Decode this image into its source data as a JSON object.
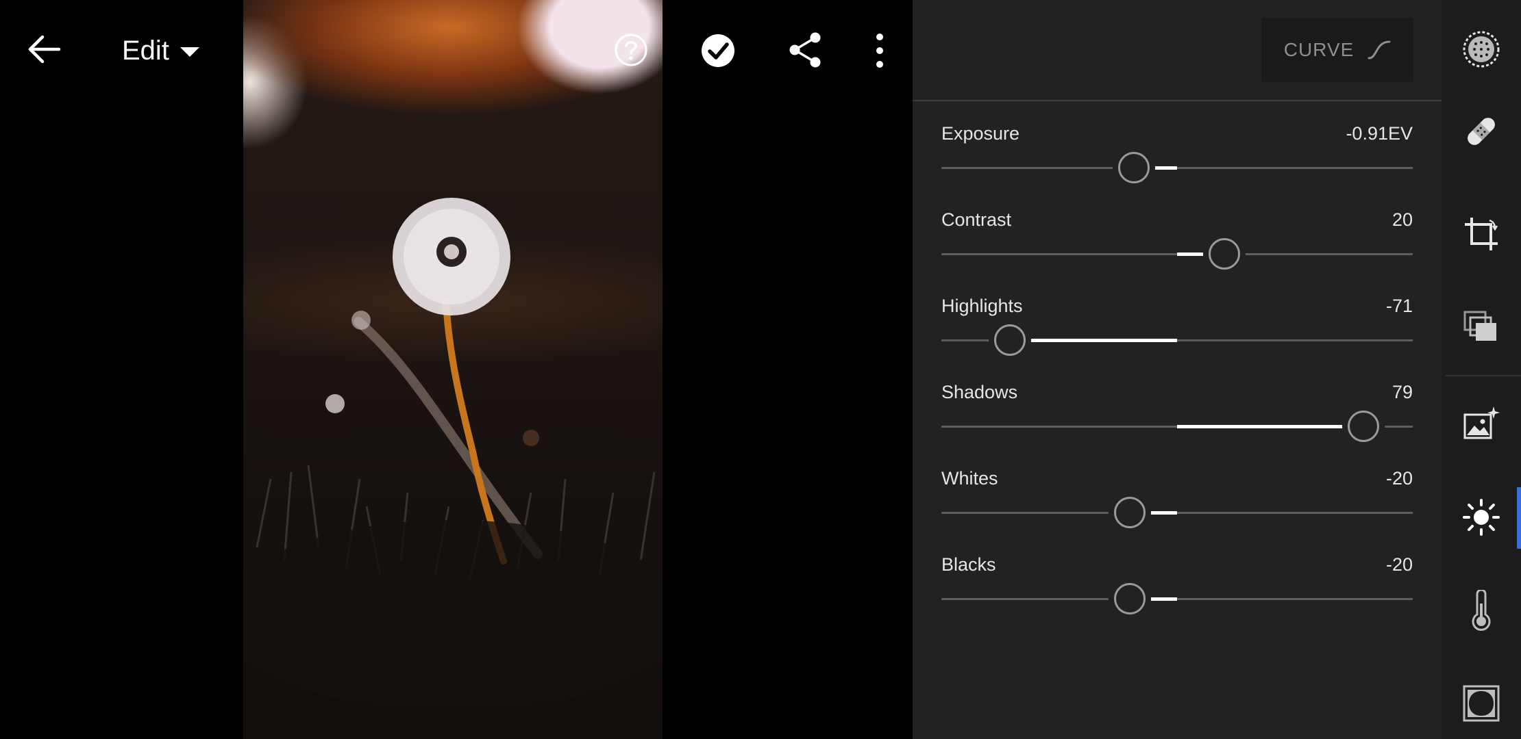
{
  "toolbar": {
    "back_icon": "back-arrow-icon",
    "edit_label": "Edit",
    "help_icon": "help-icon",
    "check_icon": "checkmark-icon",
    "share_icon": "share-icon",
    "more_icon": "more-vertical-icon"
  },
  "photo": {
    "subject": "dandelion"
  },
  "panel": {
    "curve_label": "CURVE",
    "curve_icon": "curve-icon",
    "sliders": [
      {
        "name": "Exposure",
        "value": "-0.91EV",
        "position": 0.408,
        "center": 0.5
      },
      {
        "name": "Contrast",
        "value": "20",
        "position": 0.6,
        "center": 0.5
      },
      {
        "name": "Highlights",
        "value": "-71",
        "position": 0.145,
        "center": 0.5
      },
      {
        "name": "Shadows",
        "value": "79",
        "position": 0.895,
        "center": 0.5
      },
      {
        "name": "Whites",
        "value": "-20",
        "position": 0.4,
        "center": 0.5
      },
      {
        "name": "Blacks",
        "value": "-20",
        "position": 0.4,
        "center": 0.5
      }
    ]
  },
  "rail": {
    "tools": [
      {
        "name": "selective-icon"
      },
      {
        "name": "healing-icon"
      },
      {
        "name": "crop-icon"
      },
      {
        "name": "presets-icon"
      },
      {
        "name": "auto-enhance-icon"
      },
      {
        "name": "light-icon",
        "active": true
      },
      {
        "name": "color-temperature-icon"
      },
      {
        "name": "vignette-icon"
      }
    ],
    "accent_color": "#3b6fd6"
  }
}
